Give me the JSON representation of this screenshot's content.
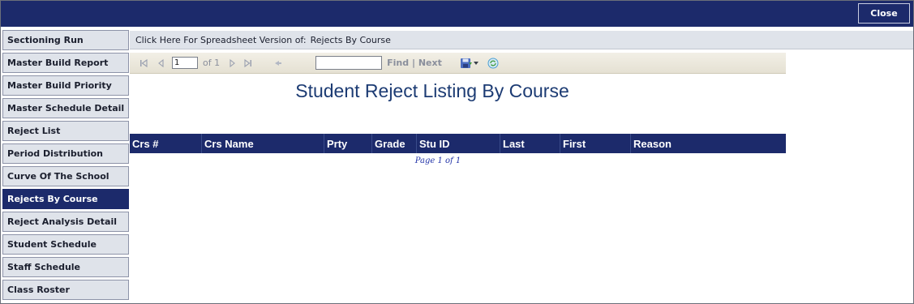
{
  "topbar": {
    "close_label": "Close"
  },
  "sidebar": {
    "items": [
      {
        "label": "Sectioning Run"
      },
      {
        "label": "Master Build Report"
      },
      {
        "label": "Master Build Priority"
      },
      {
        "label": "Master Schedule Detail"
      },
      {
        "label": "Reject List"
      },
      {
        "label": "Period Distribution"
      },
      {
        "label": "Curve Of The School"
      },
      {
        "label": "Rejects By Course",
        "active": true
      },
      {
        "label": "Reject Analysis Detail"
      },
      {
        "label": "Student Schedule"
      },
      {
        "label": "Staff Schedule"
      },
      {
        "label": "Class Roster"
      }
    ]
  },
  "spreadsheet_bar": {
    "link_text": "Click Here For Spreadsheet Version of:",
    "report_name": "Rejects By Course"
  },
  "toolbar": {
    "page_value": "1",
    "page_of": "of 1",
    "find_placeholder": "",
    "find_label": "Find",
    "separator": "|",
    "next_label": "Next"
  },
  "report": {
    "title": "Student Reject Listing By Course",
    "columns": [
      "Crs #",
      "Crs Name",
      "Prty",
      "Grade",
      "Stu ID",
      "Last",
      "First",
      "Reason"
    ],
    "page_indicator": "Page 1 of 1"
  },
  "colors": {
    "navy": "#1c2a6b",
    "sidebar_bg": "#dfe3ea",
    "title_blue": "#1c3b73"
  }
}
